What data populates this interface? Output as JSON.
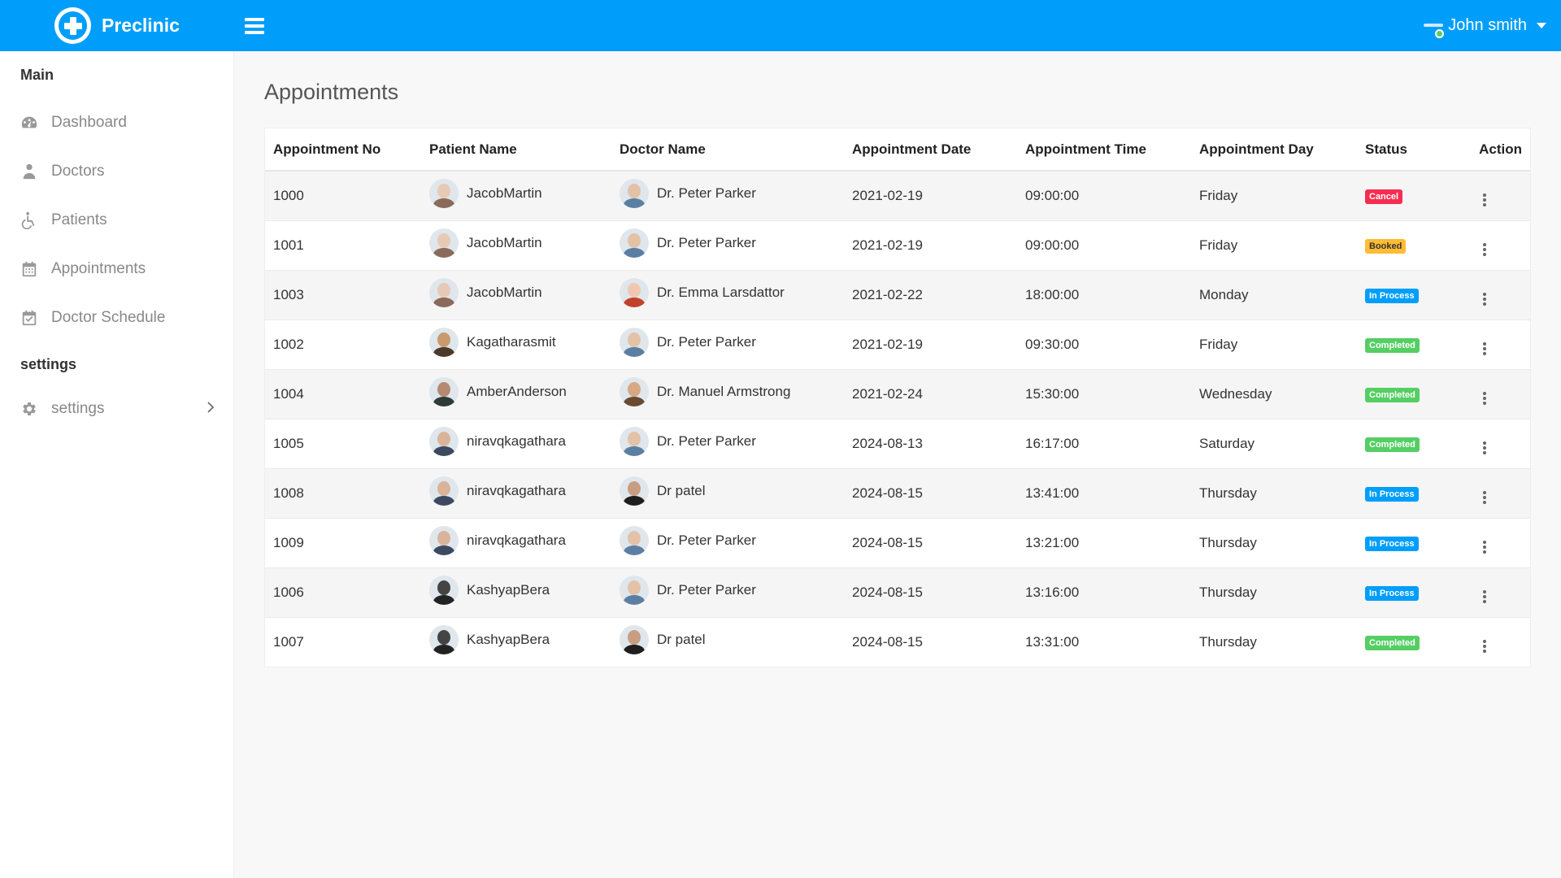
{
  "app": {
    "name": "Preclinic",
    "user_name": "John smith"
  },
  "sidebar": {
    "main_title": "Main",
    "items": [
      {
        "label": "Dashboard",
        "icon": "dashboard-icon"
      },
      {
        "label": "Doctors",
        "icon": "doctor-icon"
      },
      {
        "label": "Patients",
        "icon": "wheelchair-icon"
      },
      {
        "label": "Appointments",
        "icon": "calendar-icon"
      },
      {
        "label": "Doctor Schedule",
        "icon": "calendar-check-icon"
      }
    ],
    "settings_title": "settings",
    "settings_item": {
      "label": "settings",
      "icon": "gear-icon"
    }
  },
  "page": {
    "title": "Appointments"
  },
  "table": {
    "headers": [
      "Appointment No",
      "Patient Name",
      "Doctor Name",
      "Appointment Date",
      "Appointment Time",
      "Appointment Day",
      "Status",
      "Action"
    ],
    "rows": [
      {
        "no": "1000",
        "patient": "JacobMartin",
        "doctor": "Dr. Peter Parker",
        "date": "2021-02-19",
        "time": "09:00:00",
        "day": "Friday",
        "status": "Cancel"
      },
      {
        "no": "1001",
        "patient": "JacobMartin",
        "doctor": "Dr. Peter Parker",
        "date": "2021-02-19",
        "time": "09:00:00",
        "day": "Friday",
        "status": "Booked"
      },
      {
        "no": "1003",
        "patient": "JacobMartin",
        "doctor": "Dr. Emma Larsdattor",
        "date": "2021-02-22",
        "time": "18:00:00",
        "day": "Monday",
        "status": "In Process"
      },
      {
        "no": "1002",
        "patient": "Kagatharasmit",
        "doctor": "Dr. Peter Parker",
        "date": "2021-02-19",
        "time": "09:30:00",
        "day": "Friday",
        "status": "Completed"
      },
      {
        "no": "1004",
        "patient": "AmberAnderson",
        "doctor": "Dr. Manuel Armstrong",
        "date": "2021-02-24",
        "time": "15:30:00",
        "day": "Wednesday",
        "status": "Completed"
      },
      {
        "no": "1005",
        "patient": "niravqkagathara",
        "doctor": "Dr. Peter Parker",
        "date": "2024-08-13",
        "time": "16:17:00",
        "day": "Saturday",
        "status": "Completed"
      },
      {
        "no": "1008",
        "patient": "niravqkagathara",
        "doctor": "Dr patel",
        "date": "2024-08-15",
        "time": "13:41:00",
        "day": "Thursday",
        "status": "In Process"
      },
      {
        "no": "1009",
        "patient": "niravqkagathara",
        "doctor": "Dr. Peter Parker",
        "date": "2024-08-15",
        "time": "13:21:00",
        "day": "Thursday",
        "status": "In Process"
      },
      {
        "no": "1006",
        "patient": "KashyapBera",
        "doctor": "Dr. Peter Parker",
        "date": "2024-08-15",
        "time": "13:16:00",
        "day": "Thursday",
        "status": "In Process"
      },
      {
        "no": "1007",
        "patient": "KashyapBera",
        "doctor": "Dr patel",
        "date": "2024-08-15",
        "time": "13:31:00",
        "day": "Thursday",
        "status": "Completed"
      }
    ]
  },
  "status_colors": {
    "Cancel": {
      "bg": "#f62d51",
      "fg": "#ffffff"
    },
    "Booked": {
      "bg": "#ffbc34",
      "fg": "#333333"
    },
    "In Process": {
      "bg": "#009efb",
      "fg": "#ffffff"
    },
    "Completed": {
      "bg": "#55ce63",
      "fg": "#ffffff"
    }
  },
  "colors": {
    "accent": "#009efb"
  }
}
